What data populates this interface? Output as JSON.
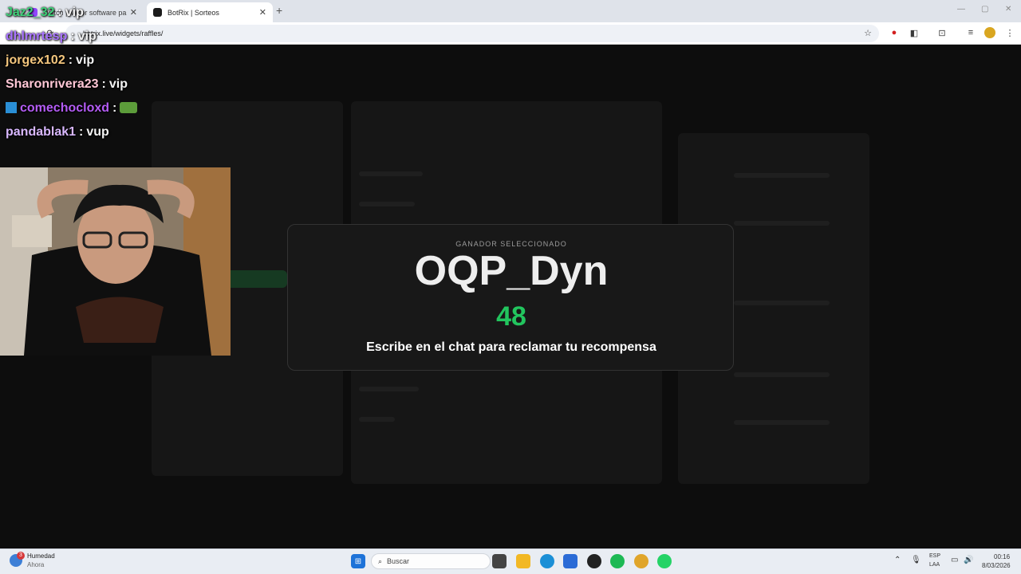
{
  "browser": {
    "tabs": [
      {
        "title": "Twitch | Mejor software pa",
        "active": false
      },
      {
        "title": "BotRix | Sorteos",
        "active": true
      }
    ],
    "url": "botrix.live/widgets/raffles/"
  },
  "chat": {
    "messages": [
      {
        "user": "Jaz2_32",
        "text": "vip",
        "user_color": "#3fd27a"
      },
      {
        "user": "dhlmrtesp",
        "text": "vip",
        "user_color": "#a974ff"
      },
      {
        "user": "jorgex102",
        "text": "vip",
        "user_color": "#f5c77e"
      },
      {
        "user": "Sharonrivera23",
        "text": "vip",
        "user_color": "#ffc7d6"
      },
      {
        "user": "comechocloxd",
        "text": "",
        "user_color": "#b45cf5"
      },
      {
        "user": "pandablak1",
        "text": "vup",
        "user_color": "#d9b8ff"
      }
    ]
  },
  "winner": {
    "label": "GANADOR SELECCIONADO",
    "name": "OQP_Dyn",
    "number": "48",
    "message": "Escribe en el chat para reclamar tu recompensa"
  },
  "taskbar": {
    "weather_title": "Humedad",
    "weather_subtitle": "Ahora",
    "weather_badge": "3",
    "search_placeholder": "Buscar",
    "lang_line1": "ESP",
    "lang_line2": "LAA",
    "time": "00:16",
    "date": "8/03/2026"
  },
  "colors": {
    "accent_green": "#22c55e",
    "page_bg": "#0d0d0d"
  }
}
